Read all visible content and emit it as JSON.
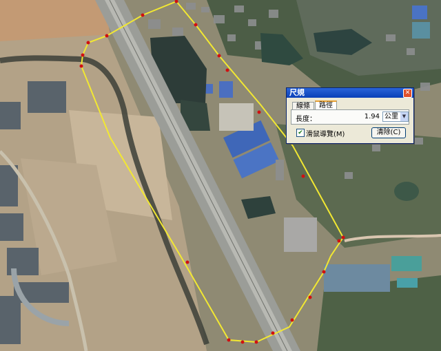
{
  "dialog": {
    "title": "尺規",
    "close_glyph": "✕",
    "tabs": [
      {
        "label": "線條",
        "active": false
      },
      {
        "label": "路徑",
        "active": true
      }
    ],
    "length_label": "長度：",
    "length_value": "1.94",
    "unit": "公里",
    "mouse_nav_label": "滑鼠導覽(M)",
    "mouse_nav_checked": true,
    "clear_label": "清除(C)"
  },
  "colors": {
    "path_line": "#f2e832",
    "path_node": "#d01010"
  }
}
